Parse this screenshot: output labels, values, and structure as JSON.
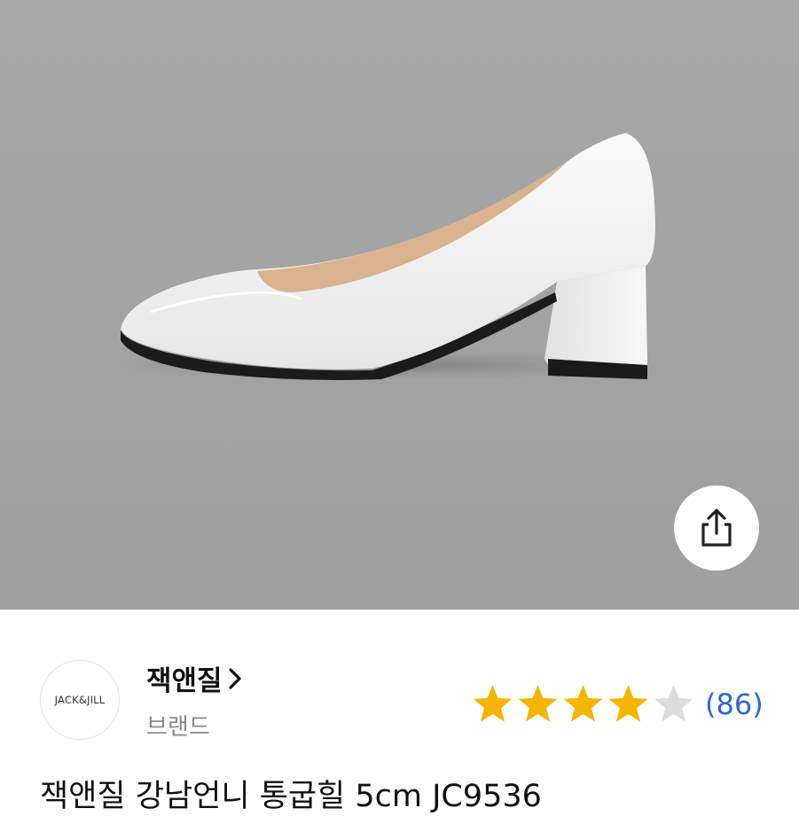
{
  "product": {
    "image_alt": "white pointed-toe block heel pump",
    "title": "잭앤질 강남언니 통굽힐 5cm JC9536"
  },
  "share": {
    "icon": "share-icon"
  },
  "brand": {
    "logo_text": "JACK&JILL",
    "name": "잭앤질",
    "subtitle": "브랜드"
  },
  "rating": {
    "stars_filled": 4,
    "stars_total": 5,
    "count_text": "(86)",
    "star_color": "#f5b400",
    "star_empty_color": "#dcdcdc"
  },
  "colors": {
    "accent": "#2d66d9"
  }
}
